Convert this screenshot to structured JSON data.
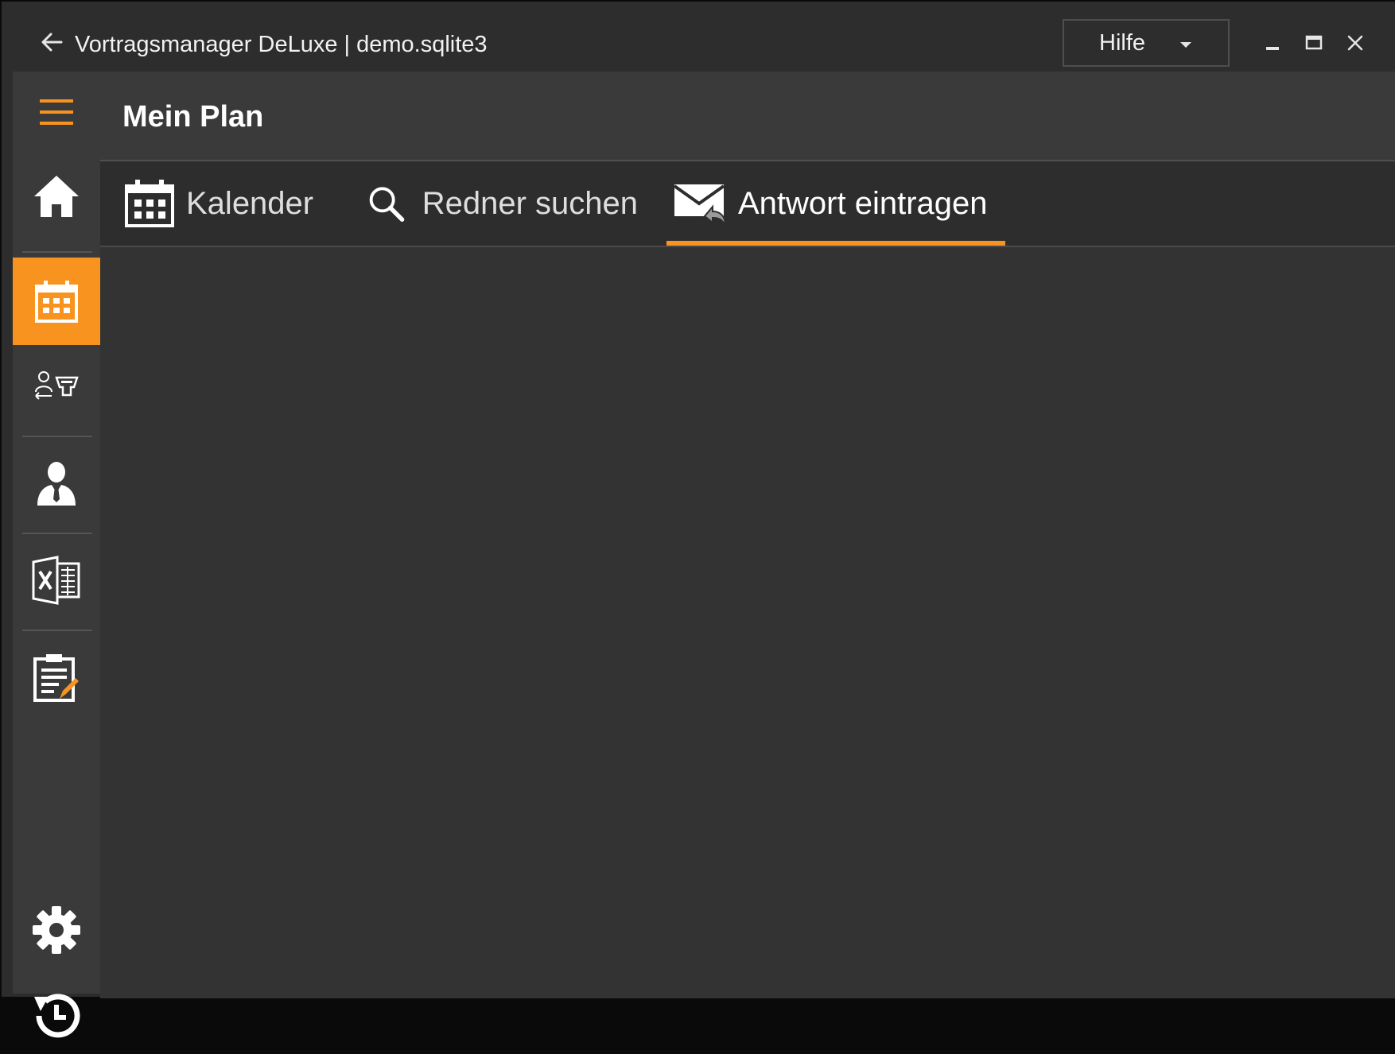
{
  "window": {
    "title": "Vortragsmanager DeLuxe | demo.sqlite3",
    "help_menu": {
      "label": "Hilfe"
    }
  },
  "header": {
    "title": "Mein Plan"
  },
  "tabs": [
    {
      "label": "Kalender",
      "icon": "calendar-icon",
      "active": false
    },
    {
      "label": "Redner suchen",
      "icon": "search-icon",
      "active": false
    },
    {
      "label": "Antwort eintragen",
      "icon": "mail-reply-icon",
      "active": true
    }
  ],
  "sidebar": {
    "items": [
      {
        "icon": "menu-icon"
      },
      {
        "icon": "home-icon"
      },
      {
        "icon": "calendar-icon",
        "active": true
      },
      {
        "icon": "speaker-podium-icon"
      },
      {
        "icon": "person-icon"
      },
      {
        "icon": "excel-icon"
      },
      {
        "icon": "clipboard-edit-icon"
      },
      {
        "icon": "gear-icon"
      },
      {
        "icon": "history-icon"
      }
    ]
  },
  "colors": {
    "accent": "#f7931e",
    "background": "#2d2d2d",
    "panel": "#3a3a3a",
    "content": "#333333"
  }
}
